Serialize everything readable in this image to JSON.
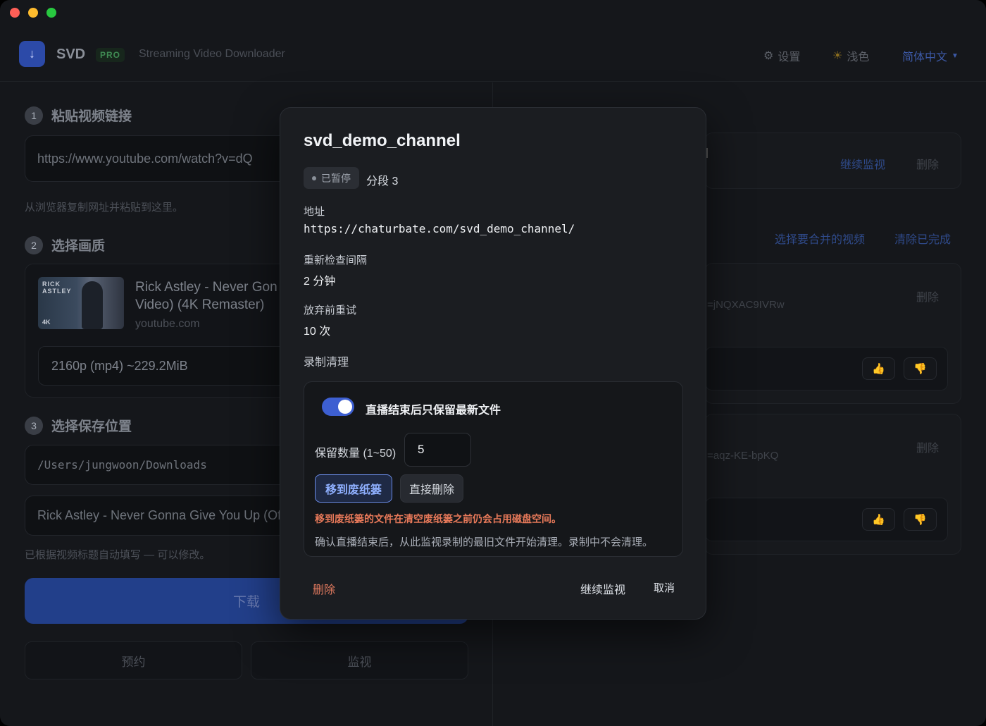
{
  "header": {
    "app_name": "SVD",
    "badge": "PRO",
    "subtitle": "Streaming Video Downloader",
    "settings": "设置",
    "theme": "浅色",
    "language": "简体中文"
  },
  "left": {
    "step1": {
      "num": "1",
      "label": "粘贴视频链接",
      "url": "https://www.youtube.com/watch?v=dQ",
      "hint": "从浏览器复制网址并粘贴到这里。"
    },
    "step2": {
      "num": "2",
      "label": "选择画质",
      "thumb_text": "RICK\nASTLEY",
      "thumb_badge": "4K",
      "title": "Rick Astley - Never Gonna Give You Up (Official Music Video) (4K Remaster)",
      "title_line1": "Rick Astley - Never Gon",
      "title_line2": "Video) (4K Remaster)",
      "site": "youtube.com",
      "quality": "2160p (mp4) ~229.2MiB"
    },
    "step3": {
      "num": "3",
      "label": "选择保存位置",
      "path": "/Users/jungwoon/Downloads",
      "filename": "Rick Astley - Never Gonna Give You Up (Off",
      "hint": "已根据视频标题自动填写 — 可以修改。"
    },
    "download": "下载",
    "schedule": "预约",
    "monitor": "监视"
  },
  "right": {
    "monitor_resume": "继续监视",
    "monitor_delete": "删除",
    "merge_select": "选择要合并的视频",
    "clear_done": "清除已完成",
    "item1_delete": "删除",
    "item1_url": "=jNQXAC9IVRw",
    "item2_delete": "删除",
    "item2_url": "=aqz-KE-bpKQ"
  },
  "modal": {
    "title": "svd_demo_channel",
    "status": "已暂停",
    "segment": "分段 3",
    "address_label": "地址",
    "address_value": "https://chaturbate.com/svd_demo_channel/",
    "interval_label": "重新检查间隔",
    "interval_value": "2 分钟",
    "retry_label": "放弃前重试",
    "retry_value": "10 次",
    "cleanup_label": "录制清理",
    "toggle_label": "直播结束后只保留最新文件",
    "keep_label": "保留数量 (1~50)",
    "keep_value": "5",
    "choice_trash": "移到废纸篓",
    "choice_delete": "直接删除",
    "warning": "移到废纸篓的文件在清空废纸篓之前仍会占用磁盘空间。",
    "note": "确认直播结束后，从此监视录制的最旧文件开始清理。录制中不会清理。",
    "delete_button": "删除",
    "resume_button": "继续监视",
    "cancel_button": "取消"
  },
  "colors": {
    "accent": "#3d5fd1",
    "danger": "#e27a5f",
    "badge_green": "#3f8a53"
  }
}
